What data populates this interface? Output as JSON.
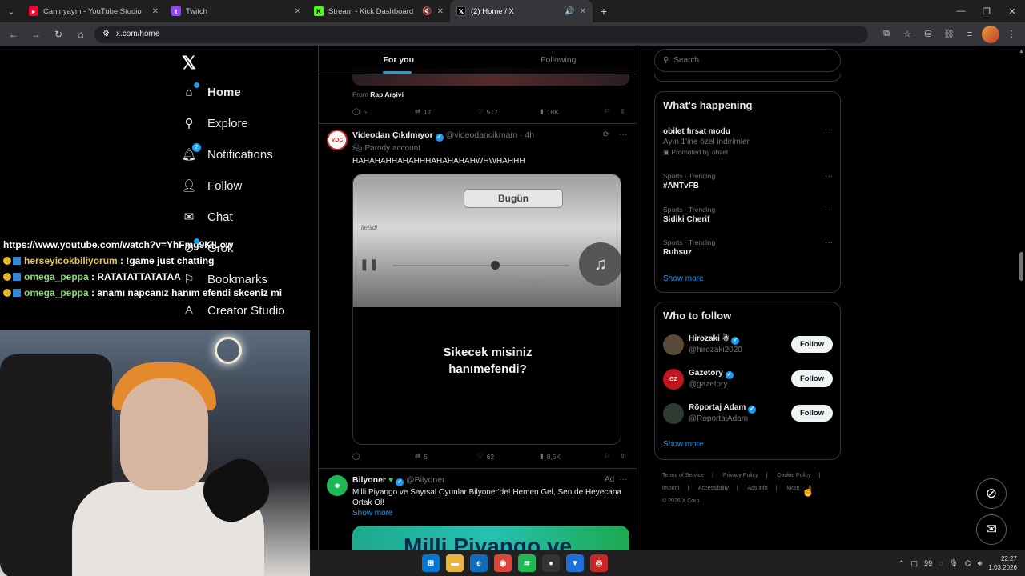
{
  "browser": {
    "tabs": [
      {
        "title": "Canlı yayın - YouTube Studio",
        "color": "#ff0033",
        "icon": "youtube-icon"
      },
      {
        "title": "Twitch",
        "color": "#9146ff",
        "icon": "twitch-icon"
      },
      {
        "title": "Stream - Kick Dashboard",
        "color": "#53fc18",
        "icon": "kick-icon"
      },
      {
        "title": "(2) Home / X",
        "color": "#000000",
        "icon": "x-icon"
      }
    ],
    "url": "x.com/home"
  },
  "overlay": {
    "chat": [
      {
        "user": "",
        "text": "https://www.youtube.com/watch?v=YhFmg9KILow"
      },
      {
        "user": "herseyicokbiliyorum",
        "text": " : !game just chatting"
      },
      {
        "user": "omega_peppa",
        "text": " : RATATATTATATAA"
      },
      {
        "user": "omega_peppa",
        "text": " : anamı napcanız hanım efendi skceniz mi"
      }
    ]
  },
  "nav": {
    "items": [
      {
        "label": "Home",
        "icon": "home-icon"
      },
      {
        "label": "Explore",
        "icon": "search-icon"
      },
      {
        "label": "Notifications",
        "icon": "bell-icon",
        "badge": "2"
      },
      {
        "label": "Follow",
        "icon": "person-add-icon"
      },
      {
        "label": "Chat",
        "icon": "mail-icon"
      },
      {
        "label": "Grok",
        "icon": "grok-icon"
      },
      {
        "label": "Bookmarks",
        "icon": "bookmark-icon"
      },
      {
        "label": "Creator Studio",
        "icon": "creator-icon"
      }
    ]
  },
  "timeline": {
    "tabs": [
      "For you",
      "Following"
    ],
    "prev": {
      "from_label": "From",
      "from_source": "Rap Arşivi",
      "replies": "5",
      "reposts": "17",
      "likes": "517",
      "views": "18K"
    },
    "post": {
      "avatar": "VDC",
      "name": "Videodan Çıkılmıyor",
      "handle": "@videodancikmam · 4h",
      "badge": "Parody account",
      "text": "HAHAHAHHAHAHHHAHAHAHAHWHWHAHHH",
      "media_button": "Bugün",
      "media_label": "iletildi",
      "media_time": "05.11.01",
      "caption_line1": "Sikecek misiniz",
      "caption_line2": "hanımefendi?",
      "replies": "",
      "reposts": "5",
      "likes": "62",
      "views": "8,5K"
    },
    "ad": {
      "name": "Bilyoner",
      "handle": "@Bilyoner",
      "ad_label": "Ad",
      "text": "Milli Piyango ve Sayısal Oyunlar Bilyoner'de! Hemen Gel, Sen de Heyecana Ortak Ol!",
      "show_more": "Show more",
      "banner": "Milli Piyango ve"
    }
  },
  "sidebar": {
    "search_placeholder": "Search",
    "happening": {
      "title": "What's happening",
      "trends": [
        {
          "category": "",
          "name": "obilet fırsat modu",
          "sub": "Ayın 1'ine özel indirimler",
          "promoted": "Promoted by obilet"
        },
        {
          "category": "Sports · Trending",
          "name": "#ANTvFB",
          "sub": "",
          "promoted": ""
        },
        {
          "category": "Sports · Trending",
          "name": "Sidiki Cherif",
          "sub": "",
          "promoted": ""
        },
        {
          "category": "Sports · Trending",
          "name": "Ruhsuz",
          "sub": "",
          "promoted": ""
        }
      ],
      "show_more": "Show more"
    },
    "who_to_follow": {
      "title": "Who to follow",
      "accounts": [
        {
          "name": "Hirozaki",
          "handle": "@hirozaki2020",
          "avatar_color": "#5a4a3a",
          "avatar": ""
        },
        {
          "name": "Gazetory",
          "handle": "@gazetory",
          "avatar_color": "#c0161f",
          "avatar": "GZ"
        },
        {
          "name": "Röportaj Adam",
          "handle": "@RoportajAdam",
          "avatar_color": "#2d3b33",
          "avatar": ""
        }
      ],
      "follow_label": "Follow",
      "show_more": "Show more"
    },
    "footer": [
      "Terms of Service",
      "Privacy Policy",
      "Cookie Policy",
      "Imprint",
      "Accessibility",
      "Ads info",
      "More ···",
      "© 2026 X Corp."
    ]
  },
  "taskbar": {
    "tray_count": "99",
    "time": "22:27",
    "date": "1.03.2026"
  }
}
